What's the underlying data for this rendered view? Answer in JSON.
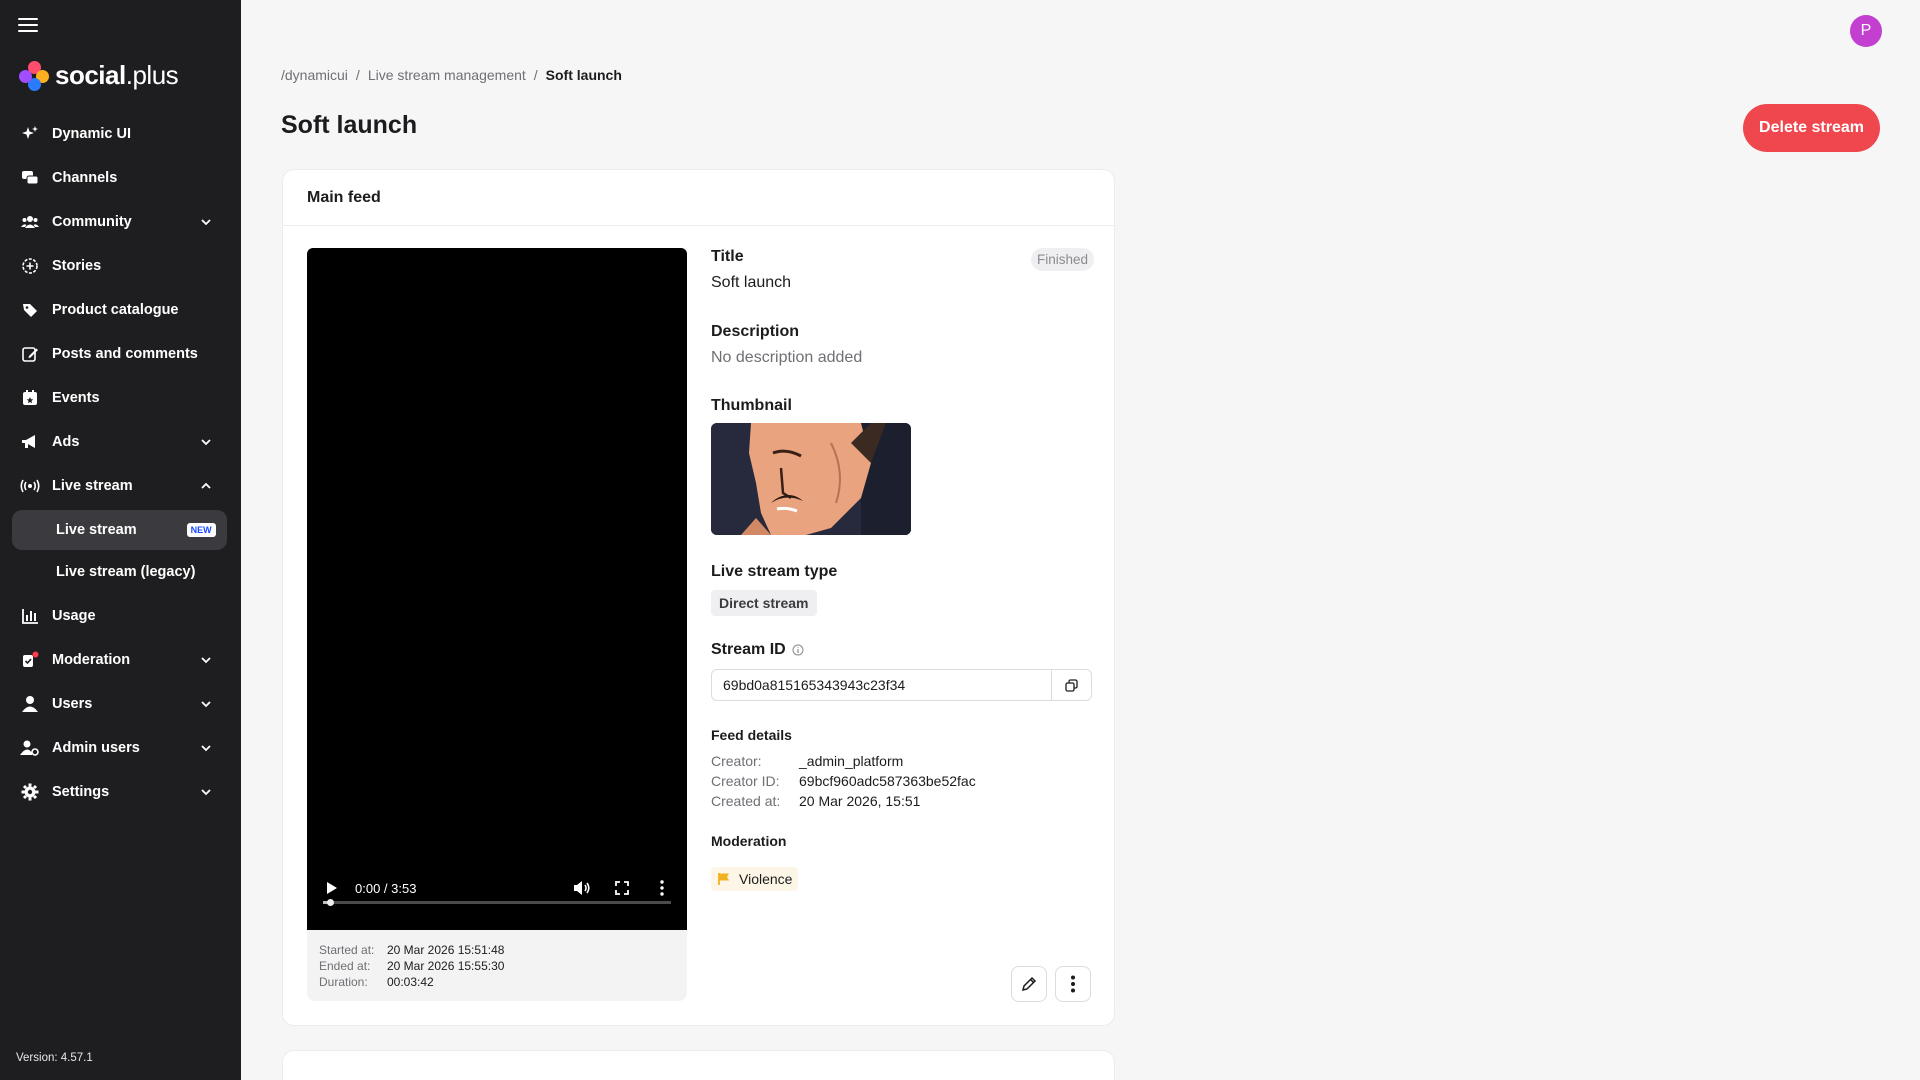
{
  "sidebar": {
    "logo": {
      "main": "social",
      "sub": "plus"
    },
    "items": [
      {
        "label": "Dynamic UI",
        "icon": "sparkles-icon"
      },
      {
        "label": "Channels",
        "icon": "chat-bubbles-icon"
      },
      {
        "label": "Community",
        "icon": "community-icon",
        "chevron": "down"
      },
      {
        "label": "Stories",
        "icon": "stories-icon"
      },
      {
        "label": "Product catalogue",
        "icon": "tag-icon"
      },
      {
        "label": "Posts and comments",
        "icon": "edit-square-icon"
      },
      {
        "label": "Events",
        "icon": "calendar-icon"
      },
      {
        "label": "Ads",
        "icon": "megaphone-icon",
        "chevron": "down"
      },
      {
        "label": "Live stream",
        "icon": "broadcast-icon",
        "chevron": "up"
      }
    ],
    "live_stream_sub": [
      {
        "label": "Live stream",
        "badge": "NEW",
        "active": true
      },
      {
        "label": "Live stream (legacy)"
      }
    ],
    "items_after": [
      {
        "label": "Usage",
        "icon": "bar-chart-icon"
      },
      {
        "label": "Moderation",
        "icon": "moderation-icon",
        "chevron": "down"
      },
      {
        "label": "Users",
        "icon": "user-icon",
        "chevron": "down"
      },
      {
        "label": "Admin users",
        "icon": "admin-user-icon",
        "chevron": "down"
      },
      {
        "label": "Settings",
        "icon": "gear-icon",
        "chevron": "down"
      }
    ],
    "version": "Version: 4.57.1"
  },
  "header": {
    "avatar_initial": "P",
    "breadcrumb": [
      "/dynamicui",
      "/",
      "Live stream management",
      "/",
      "Soft launch"
    ],
    "title": "Soft launch",
    "delete_label": "Delete stream"
  },
  "card": {
    "heading": "Main feed",
    "video": {
      "time": "0:00 / 3:53",
      "progress": 0.02,
      "meta": [
        {
          "k": "Started at:",
          "v": "20 Mar 2026 15:51:48"
        },
        {
          "k": "Ended at:",
          "v": "20 Mar 2026 15:55:30"
        },
        {
          "k": "Duration:",
          "v": "00:03:42"
        }
      ]
    },
    "details": {
      "status": "Finished",
      "title_label": "Title",
      "title_value": "Soft launch",
      "description_label": "Description",
      "description_value": "No description added",
      "thumbnail_label": "Thumbnail",
      "type_label": "Live stream type",
      "type_value": "Direct stream",
      "stream_id_label": "Stream ID",
      "stream_id_value": "69bd0a815165343943c23f34",
      "feed_details_label": "Feed details",
      "feed_details": [
        {
          "k": "Creator:",
          "v": "_admin_platform"
        },
        {
          "k": "Creator ID:",
          "v": "69bcf960adc587363be52fac"
        },
        {
          "k": "Created at:",
          "v": "20 Mar 2026, 15:51"
        }
      ],
      "moderation_label": "Moderation",
      "moderation_tag": "Violence"
    }
  },
  "colors": {
    "sidebar_bg": "#1e1e20",
    "delete_button": "#f0474f",
    "avatar": "#c23fd0",
    "flag": "#f2b120"
  }
}
